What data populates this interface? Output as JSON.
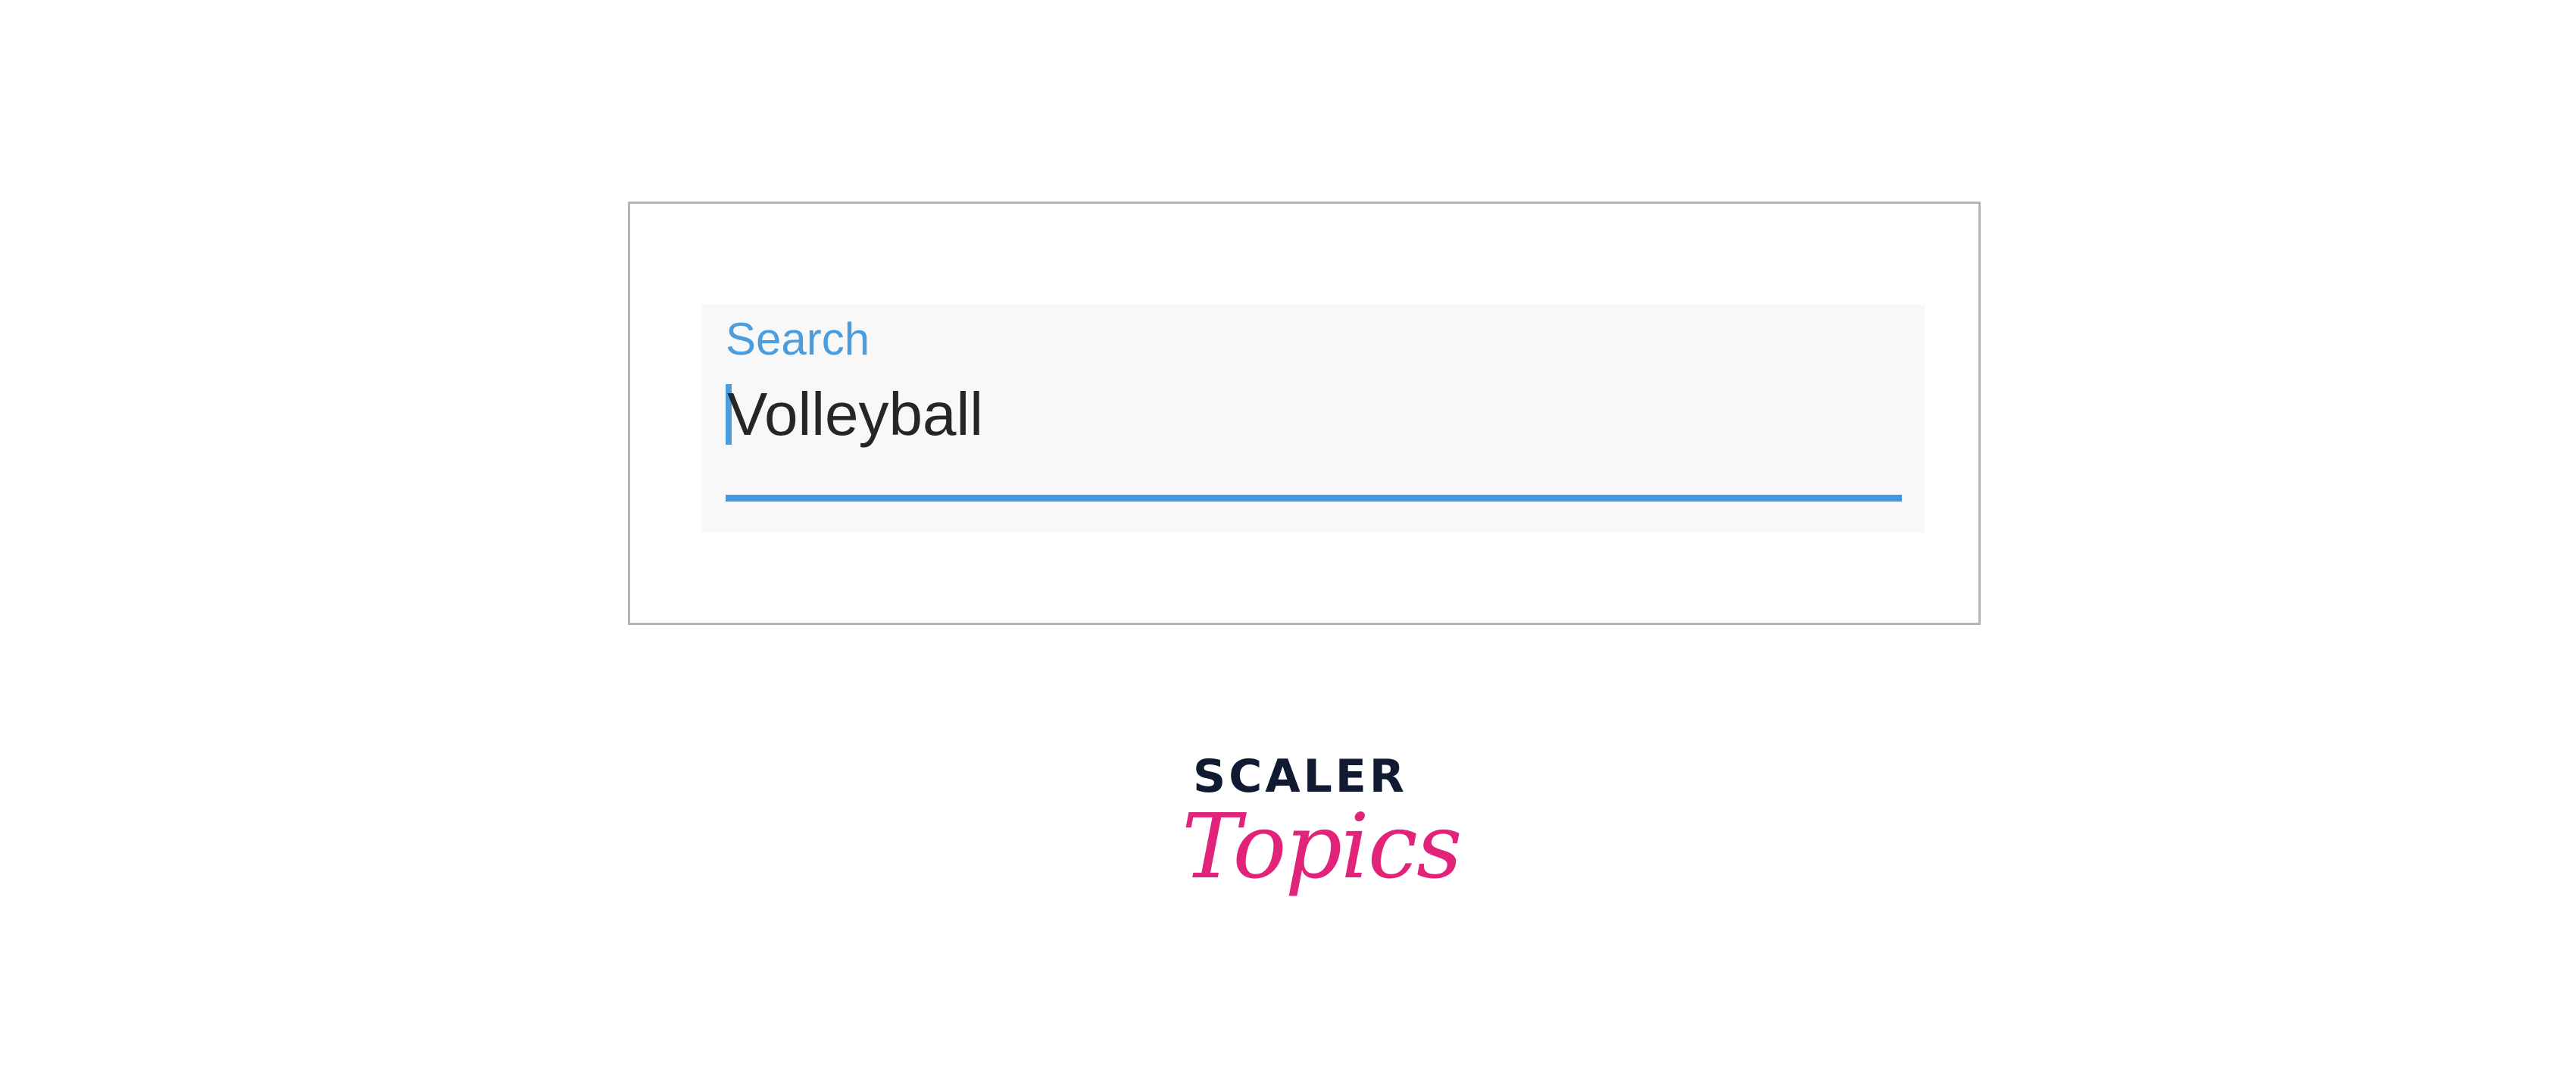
{
  "search": {
    "label": "Search",
    "value": "Volleyball"
  },
  "brand": {
    "line1": "SCALER",
    "line2": "Topics"
  },
  "colors": {
    "accent": "#3f97e6",
    "label": "#4a9ee0",
    "text": "#262626",
    "logo_dark": "#101a31",
    "logo_pink": "#e2237a"
  }
}
